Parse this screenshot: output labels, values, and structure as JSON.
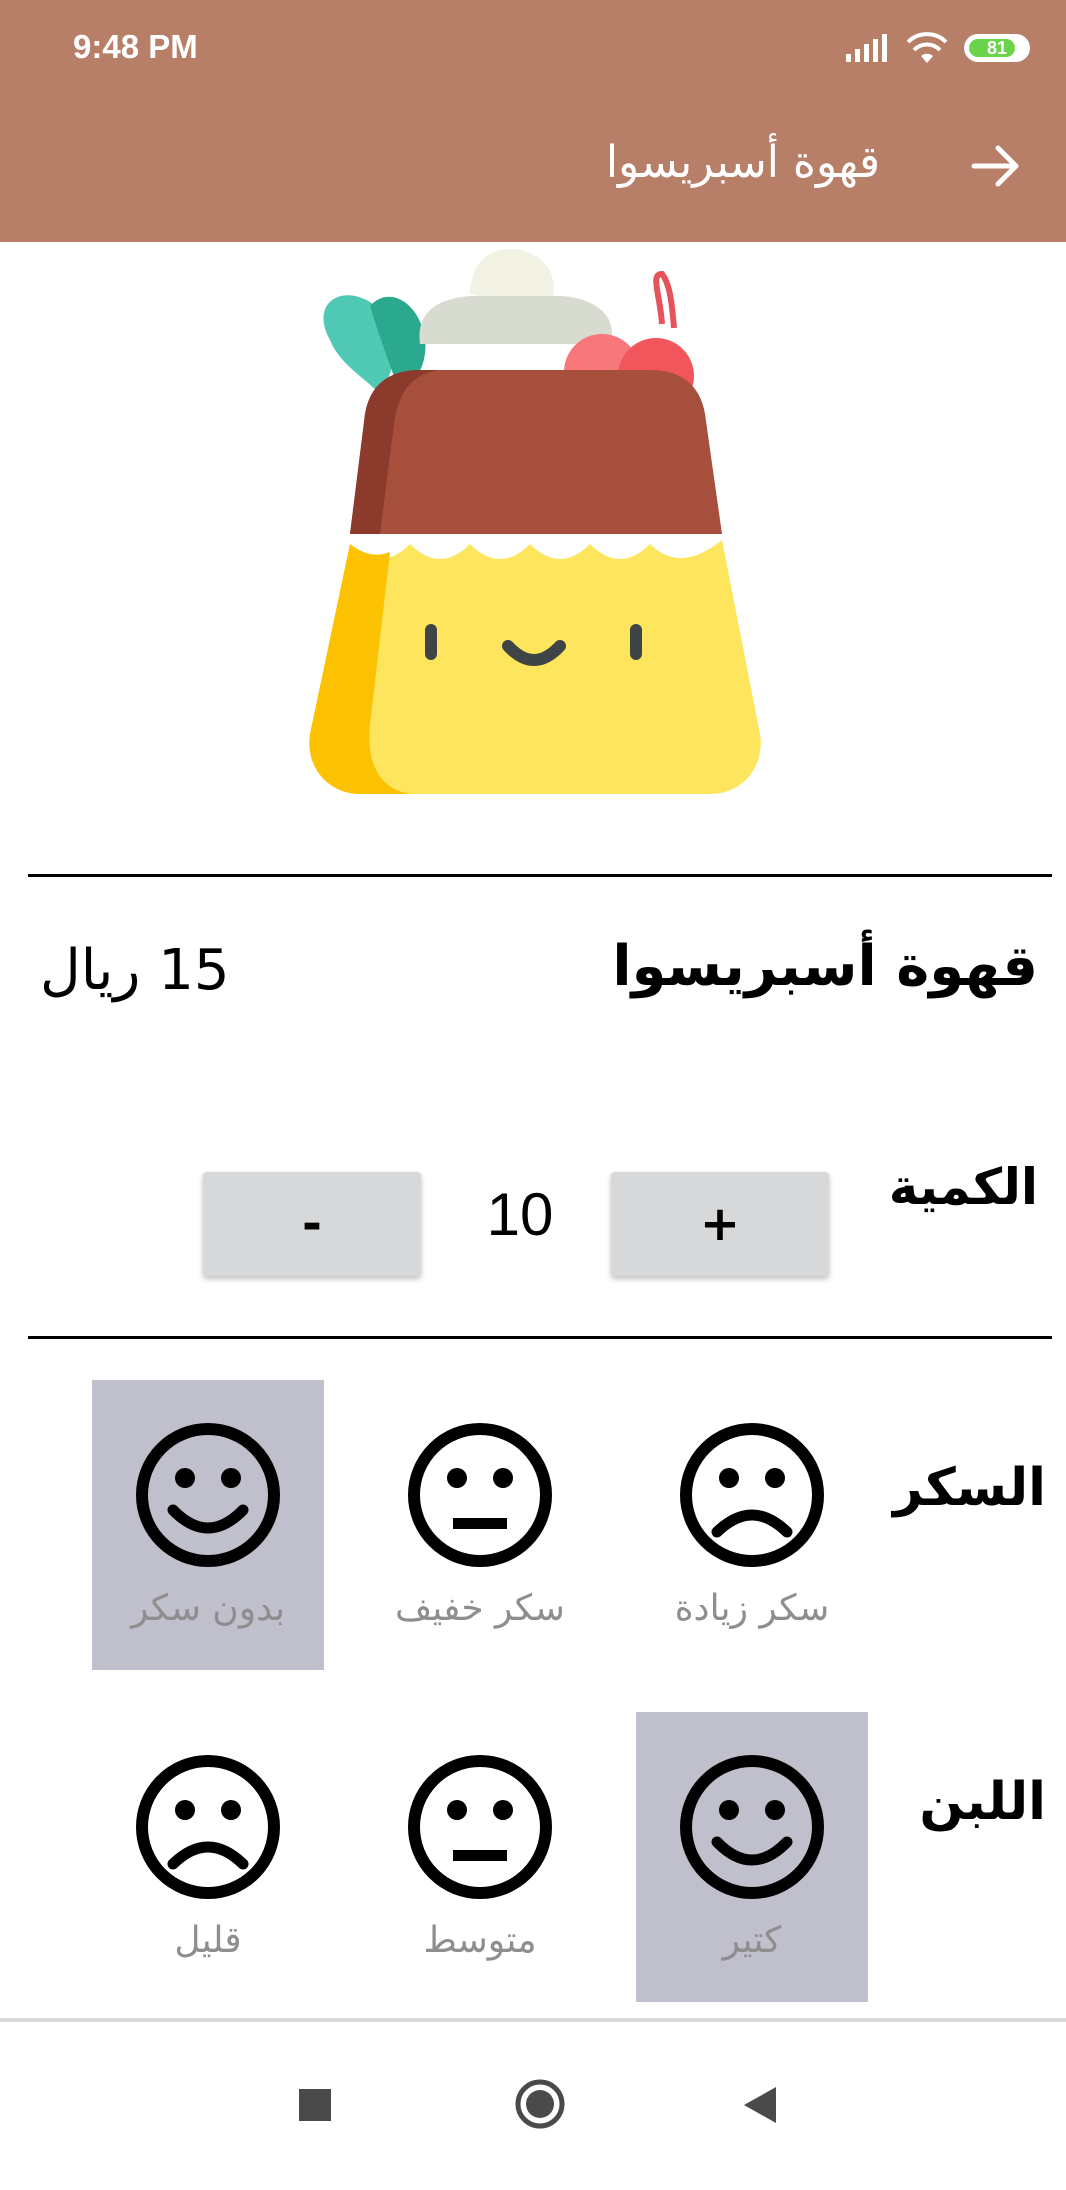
{
  "status_bar": {
    "time": "9:48 PM",
    "battery": "81",
    "battery_level_percent": 81,
    "accent_color": "#6bd34b"
  },
  "toolbar": {
    "title": "قهوة أسبريسوا",
    "back_icon": "arrow-right-icon",
    "bg_color": "#b87f68"
  },
  "hero": {
    "icon": "flan-pudding-icon"
  },
  "product": {
    "name": "قهوة أسبريسوا",
    "price": "15 ريال"
  },
  "quantity": {
    "label": "الكمية",
    "plus_label": "+",
    "minus_label": "-",
    "value": "10"
  },
  "sugar": {
    "label": "السكر",
    "options": [
      {
        "caption": "سكر زيادة",
        "icon": "sad-face-icon",
        "selected": false
      },
      {
        "caption": "سكر خفيف",
        "icon": "neutral-face-icon",
        "selected": false
      },
      {
        "caption": "بدون سكر",
        "icon": "smile-face-icon",
        "selected": true
      }
    ]
  },
  "milk": {
    "label": "اللبن",
    "options": [
      {
        "caption": "كتير",
        "icon": "smile-face-icon",
        "selected": true
      },
      {
        "caption": "متوسط",
        "icon": "neutral-face-icon",
        "selected": false
      },
      {
        "caption": "قليل",
        "icon": "sad-face-icon",
        "selected": false
      }
    ]
  },
  "nav": {
    "recents_icon": "square-icon",
    "home_icon": "circle-icon",
    "back_icon": "triangle-back-icon"
  }
}
